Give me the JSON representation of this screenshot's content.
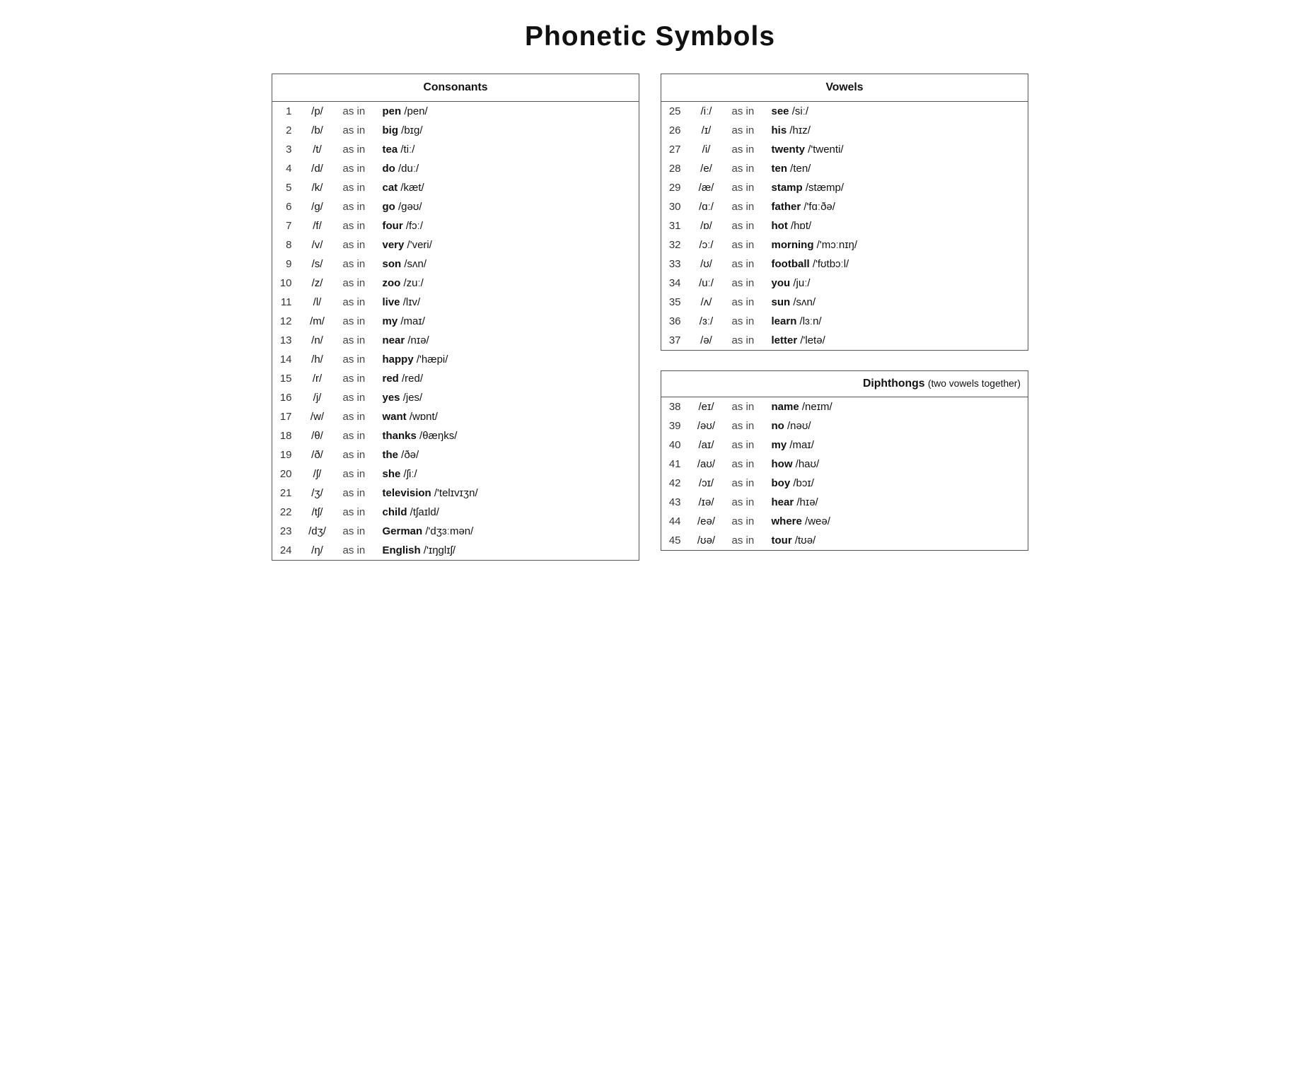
{
  "title": "Phonetic Symbols",
  "consonants": {
    "header": "Consonants",
    "rows": [
      {
        "num": "1",
        "sym": "/p/",
        "asin": "as in",
        "word": "pen",
        "ipa": "/pen/"
      },
      {
        "num": "2",
        "sym": "/b/",
        "asin": "as in",
        "word": "big",
        "ipa": "/bɪg/"
      },
      {
        "num": "3",
        "sym": "/t/",
        "asin": "as in",
        "word": "tea",
        "ipa": "/tiː/"
      },
      {
        "num": "4",
        "sym": "/d/",
        "asin": "as in",
        "word": "do",
        "ipa": "/duː/"
      },
      {
        "num": "5",
        "sym": "/k/",
        "asin": "as in",
        "word": "cat",
        "ipa": "/kæt/"
      },
      {
        "num": "6",
        "sym": "/g/",
        "asin": "as in",
        "word": "go",
        "ipa": "/gəʊ/"
      },
      {
        "num": "7",
        "sym": "/f/",
        "asin": "as in",
        "word": "four",
        "ipa": "/fɔː/"
      },
      {
        "num": "8",
        "sym": "/v/",
        "asin": "as in",
        "word": "very",
        "ipa": "/'veri/"
      },
      {
        "num": "9",
        "sym": "/s/",
        "asin": "as in",
        "word": "son",
        "ipa": "/sʌn/"
      },
      {
        "num": "10",
        "sym": "/z/",
        "asin": "as in",
        "word": "zoo",
        "ipa": "/zuː/"
      },
      {
        "num": "11",
        "sym": "/l/",
        "asin": "as in",
        "word": "live",
        "ipa": "/lɪv/"
      },
      {
        "num": "12",
        "sym": "/m/",
        "asin": "as in",
        "word": "my",
        "ipa": "/maɪ/"
      },
      {
        "num": "13",
        "sym": "/n/",
        "asin": "as in",
        "word": "near",
        "ipa": "/nɪə/"
      },
      {
        "num": "14",
        "sym": "/h/",
        "asin": "as in",
        "word": "happy",
        "ipa": "/'hæpi/"
      },
      {
        "num": "15",
        "sym": "/r/",
        "asin": "as in",
        "word": "red",
        "ipa": "/red/"
      },
      {
        "num": "16",
        "sym": "/j/",
        "asin": "as in",
        "word": "yes",
        "ipa": "/jes/"
      },
      {
        "num": "17",
        "sym": "/w/",
        "asin": "as in",
        "word": "want",
        "ipa": "/wɒnt/"
      },
      {
        "num": "18",
        "sym": "/θ/",
        "asin": "as in",
        "word": "thanks",
        "ipa": "/θæŋks/"
      },
      {
        "num": "19",
        "sym": "/ð/",
        "asin": "as in",
        "word": "the",
        "ipa": "/ðə/"
      },
      {
        "num": "20",
        "sym": "/ʃ/",
        "asin": "as in",
        "word": "she",
        "ipa": "/ʃiː/"
      },
      {
        "num": "21",
        "sym": "/ʒ/",
        "asin": "as in",
        "word": "television",
        "ipa": "/'telɪvɪʒn/"
      },
      {
        "num": "22",
        "sym": "/tʃ/",
        "asin": "as in",
        "word": "child",
        "ipa": "/tʃaɪld/"
      },
      {
        "num": "23",
        "sym": "/dʒ/",
        "asin": "as in",
        "word": "German",
        "ipa": "/'dʒɜːmən/"
      },
      {
        "num": "24",
        "sym": "/ŋ/",
        "asin": "as in",
        "word": "English",
        "ipa": "/'ɪŋglɪʃ/"
      }
    ]
  },
  "vowels": {
    "header": "Vowels",
    "rows": [
      {
        "num": "25",
        "sym": "/iː/",
        "asin": "as in",
        "word": "see",
        "ipa": "/siː/"
      },
      {
        "num": "26",
        "sym": "/ɪ/",
        "asin": "as in",
        "word": "his",
        "ipa": "/hɪz/"
      },
      {
        "num": "27",
        "sym": "/i/",
        "asin": "as in",
        "word": "twenty",
        "ipa": "/'twenti/"
      },
      {
        "num": "28",
        "sym": "/e/",
        "asin": "as in",
        "word": "ten",
        "ipa": "/ten/"
      },
      {
        "num": "29",
        "sym": "/æ/",
        "asin": "as in",
        "word": "stamp",
        "ipa": "/stæmp/"
      },
      {
        "num": "30",
        "sym": "/ɑː/",
        "asin": "as in",
        "word": "father",
        "ipa": "/'fɑːðə/"
      },
      {
        "num": "31",
        "sym": "/ɒ/",
        "asin": "as in",
        "word": "hot",
        "ipa": "/hɒt/"
      },
      {
        "num": "32",
        "sym": "/ɔː/",
        "asin": "as in",
        "word": "morning",
        "ipa": "/'mɔːnɪŋ/"
      },
      {
        "num": "33",
        "sym": "/ʊ/",
        "asin": "as in",
        "word": "football",
        "ipa": "/'fʊtbɔːl/"
      },
      {
        "num": "34",
        "sym": "/uː/",
        "asin": "as in",
        "word": "you",
        "ipa": "/juː/"
      },
      {
        "num": "35",
        "sym": "/ʌ/",
        "asin": "as in",
        "word": "sun",
        "ipa": "/sʌn/"
      },
      {
        "num": "36",
        "sym": "/ɜː/",
        "asin": "as in",
        "word": "learn",
        "ipa": "/lɜːn/"
      },
      {
        "num": "37",
        "sym": "/ə/",
        "asin": "as in",
        "word": "letter",
        "ipa": "/'letə/"
      }
    ]
  },
  "diphthongs": {
    "header": "Diphthongs",
    "subheader": "(two vowels together)",
    "rows": [
      {
        "num": "38",
        "sym": "/eɪ/",
        "asin": "as in",
        "word": "name",
        "ipa": "/neɪm/"
      },
      {
        "num": "39",
        "sym": "/əʊ/",
        "asin": "as in",
        "word": "no",
        "ipa": "/nəʊ/"
      },
      {
        "num": "40",
        "sym": "/aɪ/",
        "asin": "as in",
        "word": "my",
        "ipa": "/maɪ/"
      },
      {
        "num": "41",
        "sym": "/aʊ/",
        "asin": "as in",
        "word": "how",
        "ipa": "/haʊ/"
      },
      {
        "num": "42",
        "sym": "/ɔɪ/",
        "asin": "as in",
        "word": "boy",
        "ipa": "/bɔɪ/"
      },
      {
        "num": "43",
        "sym": "/ɪə/",
        "asin": "as in",
        "word": "hear",
        "ipa": "/hɪə/"
      },
      {
        "num": "44",
        "sym": "/eə/",
        "asin": "as in",
        "word": "where",
        "ipa": "/weə/"
      },
      {
        "num": "45",
        "sym": "/ʊə/",
        "asin": "as in",
        "word": "tour",
        "ipa": "/tʊə/"
      }
    ]
  }
}
